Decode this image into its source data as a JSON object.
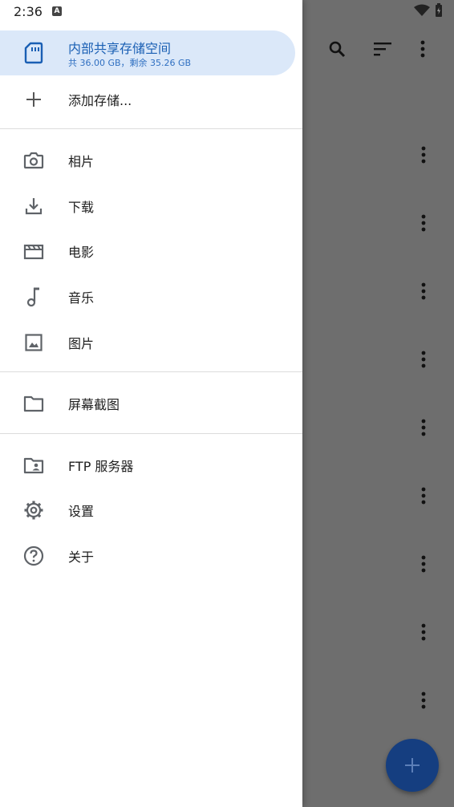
{
  "status_bar": {
    "time": "2:36",
    "notification_icon": "a-notification-icon"
  },
  "drawer": {
    "storage": {
      "title": "内部共享存储空间",
      "subtitle": "共 36.00 GB，剩余 35.26 GB"
    },
    "add_storage": "添加存储...",
    "places": [
      {
        "label": "相片",
        "icon": "camera-icon"
      },
      {
        "label": "下载",
        "icon": "download-icon"
      },
      {
        "label": "电影",
        "icon": "movie-icon"
      },
      {
        "label": "音乐",
        "icon": "music-note-icon"
      },
      {
        "label": "图片",
        "icon": "image-icon"
      }
    ],
    "bookmarks": [
      {
        "label": "屏幕截图",
        "icon": "folder-icon"
      }
    ],
    "tools": [
      {
        "label": "FTP 服务器",
        "icon": "shared-folder-icon"
      },
      {
        "label": "设置",
        "icon": "gear-icon"
      },
      {
        "label": "关于",
        "icon": "help-icon"
      }
    ]
  },
  "background_app": {
    "toolbar_icons": [
      "search-icon",
      "sort-icon",
      "more-vert-icon"
    ],
    "row_count": 9,
    "fab_icon": "add-icon"
  },
  "colors": {
    "accent": "#1a5fb4",
    "selected_bg": "#dbe8f9",
    "scrim": "#6e6e6e",
    "fab": "#153e80"
  }
}
